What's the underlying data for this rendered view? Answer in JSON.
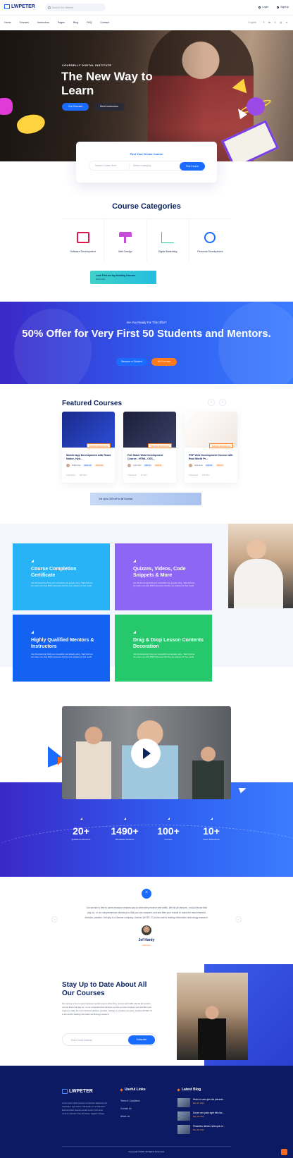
{
  "header": {
    "logo_text": "LWPETER",
    "search_placeholder": "Search Our Website",
    "login": "Login",
    "signup": "SignUp"
  },
  "nav": {
    "items": [
      "Home",
      "Courses",
      "Instructors",
      "Pages",
      "Blog",
      "FAQ",
      "Contact"
    ],
    "language": "English",
    "social_icons": [
      "facebook-icon",
      "linkedin-icon",
      "twitter-icon",
      "instagram-icon",
      "vimeo-icon"
    ]
  },
  "hero": {
    "eyebrow": "COURSELLY DIGITAL INSTITUTE",
    "title": "The New Way to Learn",
    "primary_button": "Our Courses",
    "secondary_button": "Meet Instructors"
  },
  "find_course": {
    "title": "Find Your Dream Course",
    "input_placeholder": "Search Course Here",
    "select_value": "Select a category",
    "button": "Find Course"
  },
  "categories": {
    "title": "Course Categories",
    "items": [
      {
        "label": "Software Development",
        "icon": "monitor-icon",
        "color": "#e3154c"
      },
      {
        "label": "Web Design",
        "icon": "paint-roller-icon",
        "color": "#c74bd9"
      },
      {
        "label": "Digital Marketing",
        "icon": "bar-chart-icon",
        "color": "#2fc7a0"
      },
      {
        "label": "Personal Development",
        "icon": "smile-icon",
        "color": "#1a6cff"
      }
    ],
    "banner_title": "Look Find our top trending Courses",
    "banner_sub": "Know more"
  },
  "offer": {
    "eyebrow": "Are You Ready For This Offer?",
    "title": "50% Offer for Very First 50 Students and Mentors.",
    "primary_button": "Become a Student",
    "secondary_button": "All Courses"
  },
  "featured": {
    "title": "Featured Courses",
    "courses": [
      {
        "tag": "Software Development",
        "title": "Mobile App Development with React Native, Hyb...",
        "author": "Robin Alex",
        "price": "$311.00",
        "old_price": "$125.00",
        "lessons": "6 Students",
        "time": "20h 40m"
      },
      {
        "tag": "Software Development",
        "title": "Full Stack Web Development Course - HTML, CSS...",
        "author": "John Deo",
        "price": "$48.00",
        "old_price": "$35.00",
        "lessons": "4 Students",
        "time": "3h 12m"
      },
      {
        "tag": "Software Development",
        "title": "PHP Web Development Course with Real World Pr...",
        "author": "Jack Hunt",
        "price": "$48.00",
        "old_price": "$35.00",
        "lessons": "2 Students",
        "time": "15h 18m"
      }
    ],
    "banner": "Get Up to 30% off for all Courses"
  },
  "features": {
    "items": [
      {
        "title": "Course Completion Certificate",
        "text": "Use this E-learning Tools your competitors are already using - Start Now! we top mean more than 8000 businesses find the best software for their needs.",
        "color": "#27b3f5"
      },
      {
        "title": "Quizzes, Videos, Code Snippets & More",
        "text": "Use this E-learning Tools your competitors are already using - Start Now! we top mean more than 8000 businesses find the best software for their needs.",
        "color": "#8e66f5"
      },
      {
        "title": "Highly Qualified Mentors & Instructors",
        "text": "Use this E-learning Tools your competitors are already using - Start Now! we top mean more than 8000 businesses find the best software for their needs.",
        "color": "#1362f2"
      },
      {
        "title": "Drag & Drop Lesson Contents Decoration",
        "text": "Use this E-learning Tools your competitors are already using - Start Now! we top mean more than 8000 businesses find the best software for their needs.",
        "color": "#25c96b"
      }
    ]
  },
  "stats": [
    {
      "value": "20+",
      "label": "Qualified Instructors"
    },
    {
      "value": "1490+",
      "label": "Worldwide Students"
    },
    {
      "value": "100+",
      "label": "Courses"
    },
    {
      "value": "10+",
      "label": "Years' Experience"
    }
  ],
  "testimonial": {
    "text": "Our service is free to users because vendors pay us when they receive web traffic. We list all vendors - not just those that pay us - in our comprehensive directory so that you can compare, sort and filter your results to make the most informed decision possible. Get App is a Gartner company. Gartner (NYSE: IT) is the world's leading information technology research.",
    "name": "Jef Hardy",
    "role": "Instructor"
  },
  "newsletter": {
    "title": "Stay Up to Date About All Our Courses",
    "text": "Our service is free to users because vendors pay us when they receive web traffic. We list all vendors - not just those that pay us - in our comprehensive directory so that you can compare, sort and filter your results to make the most informed decision possible. GetApp is a Gartner company. Gartner (NYSE: IT) is the world's leading information technology research.",
    "placeholder": "Enter Email Address",
    "button": "Subscribe"
  },
  "footer": {
    "logo_text": "LWPETER",
    "about": "Lorem ipsum dolor sit amet consectetur adipiscing elit. Vestibulum eget dictum sollicitudin orci at bibendum. Euismod dolor posuere iaculis a enim proin amet tempus vulputate vitae elit finibus. Sagittis tristique.",
    "links_title": "Useful Links",
    "links": [
      "Terms & Conditions",
      "Contact Us",
      "About Us"
    ],
    "blog_title": "Latest Blog",
    "posts": [
      {
        "title": "Morbi in sem quis dui placerat...",
        "date": "May 18, 2022"
      },
      {
        "title": "Donec nec justo eget felis fac...",
        "date": "May 18, 2022"
      },
      {
        "title": "Phasellus ultrices nulla quis ni...",
        "date": "May 18, 2022"
      }
    ],
    "copyright": "Copyright ©2022. All Rights Reserved."
  }
}
